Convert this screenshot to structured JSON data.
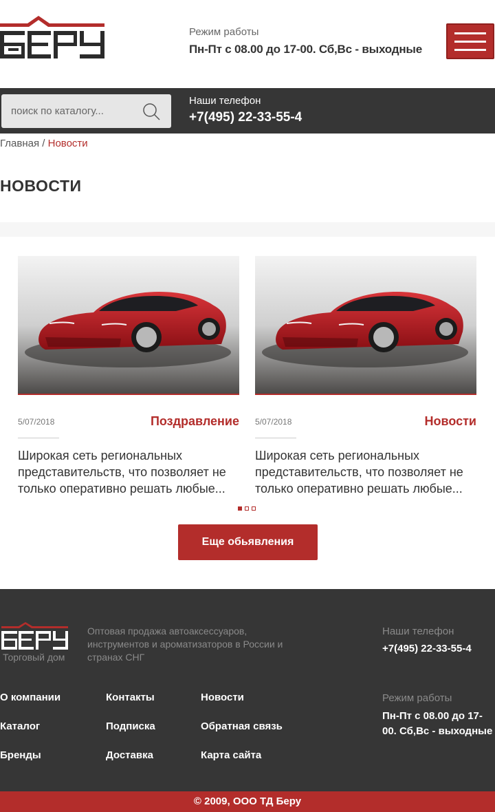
{
  "header": {
    "logo_text": "БЕРУ",
    "work_label": "Режим работы",
    "work_hours": "Пн-Пт с 08.00 до 17-00. Сб,Вс - выходные",
    "menu_icon": "hamburger-icon"
  },
  "bar": {
    "search_placeholder": "поиск по каталогу...",
    "search_icon": "search-icon",
    "phones_label": "Наши телефон",
    "phone": "+7(495) 22-33-55-4"
  },
  "breadcrumb": {
    "home": "Главная",
    "separator": " / ",
    "current": "Новости"
  },
  "page_title": "НОВОСТИ",
  "news": [
    {
      "date": "5/07/2018",
      "category": "Поздравление",
      "text": "Широкая сеть региональных представительств, что позволяет не только оперативно решать любые..."
    },
    {
      "date": "5/07/2018",
      "category": "Новости",
      "text": "Широкая сеть региональных представительств, что позволяет не только оперативно решать любые..."
    }
  ],
  "pagination": {
    "total": 3,
    "active": 1
  },
  "more_button": "Еще обьявления",
  "footer": {
    "logo_text": "БЕРУ",
    "logo_sub": "Торговый дом",
    "description": "Оптовая продажа автоаксессуаров, инструментов и ароматизаторов в России и странах СНГ",
    "phone_label": "Наши телефон",
    "phone": "+7(495) 22-33-55-4",
    "work_label": "Режим работы",
    "work_hours": "Пн-Пт с 08.00 до 17-00. Сб,Вс - выходные",
    "links": {
      "col1": [
        "О компании",
        "Каталог",
        "Бренды"
      ],
      "col2": [
        "Контакты",
        "Подписка",
        "Доставка"
      ],
      "col3": [
        "Новости",
        "Обратная связь",
        "Карта сайта"
      ]
    }
  },
  "copyright": "© 2009, ООО ТД Беру",
  "colors": {
    "accent": "#b32d2b",
    "dark": "#363636"
  }
}
